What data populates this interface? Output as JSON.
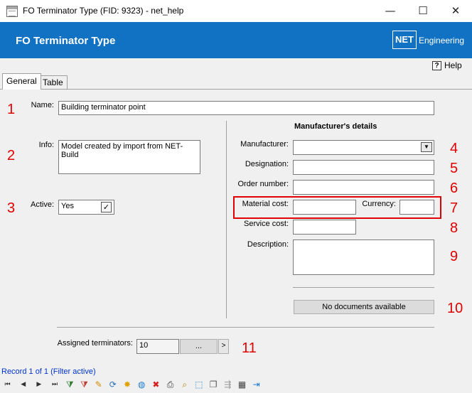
{
  "window": {
    "title": "FO Terminator Type (FID: 9323) - net_help",
    "minimize": "—",
    "maximize": "☐",
    "close": "✕"
  },
  "header": {
    "title": "FO Terminator Type",
    "logo_text": "NET",
    "brand_text": "Engineering",
    "background": "#1172c4"
  },
  "help": {
    "label": "Help",
    "icon": "?"
  },
  "tabs": [
    {
      "label": "General",
      "active": true
    },
    {
      "label": "Table",
      "active": false
    }
  ],
  "form": {
    "name": {
      "label": "Name:",
      "value": "Building terminator point"
    },
    "info": {
      "label": "Info:",
      "value": "Model created by import from NET-Build"
    },
    "active": {
      "label": "Active:",
      "value": "Yes",
      "checked": "✓"
    },
    "manufacturer_section": {
      "title": "Manufacturer's details",
      "manufacturer": {
        "label": "Manufacturer:",
        "value": "",
        "arrow": "▼"
      },
      "designation": {
        "label": "Designation:",
        "value": ""
      },
      "order_number": {
        "label": "Order number:",
        "value": ""
      },
      "material_cost": {
        "label": "Material cost:",
        "value": ""
      },
      "currency": {
        "label": "Currency:",
        "value": ""
      },
      "service_cost": {
        "label": "Service cost:",
        "value": ""
      },
      "description": {
        "label": "Description:",
        "value": ""
      },
      "documents_button": "No documents available"
    },
    "assigned_terminators": {
      "label": "Assigned terminators:",
      "value": "10",
      "browse": "...",
      "next": ">"
    }
  },
  "callouts": [
    "1",
    "2",
    "3",
    "4",
    "5",
    "6",
    "7",
    "8",
    "9",
    "10",
    "11"
  ],
  "callout_color": "#e00000",
  "status": {
    "record_text": "Record 1 of 1 (Filter active)"
  },
  "toolbar": [
    {
      "icon": "first-record-icon",
      "glyph": "⏮"
    },
    {
      "icon": "previous-record-icon",
      "glyph": "◀"
    },
    {
      "icon": "next-record-icon",
      "glyph": "▶"
    },
    {
      "icon": "last-record-icon",
      "glyph": "⏭"
    },
    {
      "icon": "add-filter-icon",
      "glyph": "⧩"
    },
    {
      "icon": "clear-filter-icon",
      "glyph": "⧩"
    },
    {
      "icon": "edit-icon",
      "glyph": "✎"
    },
    {
      "icon": "refresh-icon",
      "glyph": "⟳"
    },
    {
      "icon": "new-record-icon",
      "glyph": "✸"
    },
    {
      "icon": "web-icon",
      "glyph": "◍"
    },
    {
      "icon": "delete-icon",
      "glyph": "✖"
    },
    {
      "icon": "print-icon",
      "glyph": "⎙"
    },
    {
      "icon": "zoom-icon",
      "glyph": "⌕"
    },
    {
      "icon": "select-icon",
      "glyph": "⬚"
    },
    {
      "icon": "copy-icon",
      "glyph": "❐"
    },
    {
      "icon": "link-icon",
      "glyph": "⇶"
    },
    {
      "icon": "table-edit-icon",
      "glyph": "▦"
    },
    {
      "icon": "exit-icon",
      "glyph": "⇥"
    }
  ]
}
